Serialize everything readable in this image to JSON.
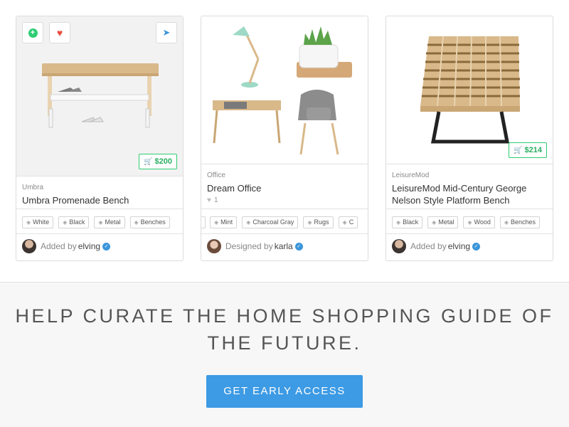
{
  "cards": [
    {
      "brand": "Umbra",
      "title": "Umbra Promenade Bench",
      "price": "$200",
      "tags": [
        "White",
        "Black",
        "Metal",
        "Benches"
      ],
      "added_label": "Added by",
      "user": "elving"
    },
    {
      "brand": "Office",
      "title": "Dream Office",
      "likes": "1",
      "tags": [
        "",
        "Mint",
        "Charcoal Gray",
        "Rugs",
        "C"
      ],
      "added_label": "Designed by",
      "user": "karla"
    },
    {
      "brand": "LeisureMod",
      "title": "LeisureMod Mid-Century George Nelson Style Platform Bench",
      "price": "$214",
      "tags": [
        "Black",
        "Metal",
        "Wood",
        "Benches"
      ],
      "added_label": "Added by",
      "user": "elving"
    }
  ],
  "icons": {
    "add": "plus-circle-icon",
    "favorite": "heart-icon",
    "share": "send-icon",
    "cart": "cart-icon",
    "tag": "tag-icon",
    "verified": "verified-badge-icon"
  },
  "colors": {
    "accent": "#3d9ae4",
    "price_green": "#2ecc71",
    "heart_red": "#e74c3c",
    "verified_blue": "#3b96db"
  },
  "promo": {
    "headline": "HELP CURATE THE HOME SHOPPING GUIDE OF THE FUTURE.",
    "cta_label": "GET EARLY ACCESS"
  }
}
